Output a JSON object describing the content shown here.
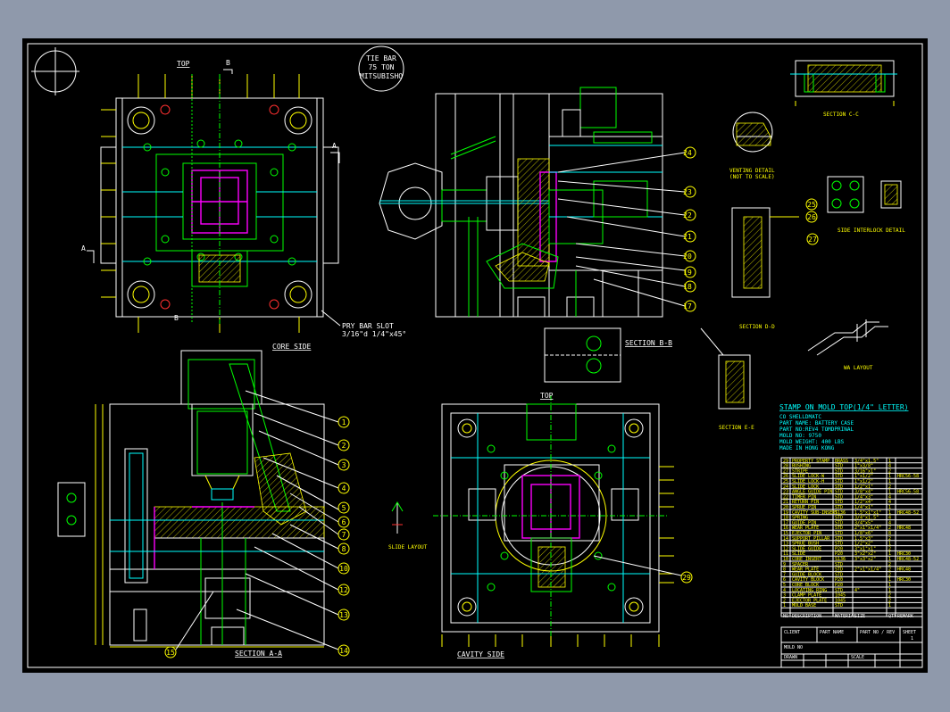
{
  "views": {
    "top_left": "TOP",
    "core_side": "CORE SIDE",
    "section_bb": "SECTION B-B",
    "section_aa": "SECTION A-A",
    "top_right": "TOP",
    "cavity_side": "CAVITY SIDE",
    "section_cc": "SECTION C-C",
    "section_dd": "SECTION D-D",
    "section_ee": "SECTION E-E",
    "venting_detail": "VENTING DETAIL",
    "venting_note": "(NOT TO SCALE)",
    "side_interlock": "SIDE INTERLOCK DETAIL",
    "slide_layout": "SLIDE LAYOUT",
    "wa_layout": "WA LAYOUT"
  },
  "tie_bar": [
    "TIE BAR",
    "75 TON",
    "MITSUBISHO"
  ],
  "pry_bar_note": [
    "PRY BAR SLOT",
    "3/16\"d 1/4\"x45°"
  ],
  "cut_marks": [
    "A",
    "A",
    "B",
    "B"
  ],
  "balloons_aa": [
    "1",
    "2",
    "3",
    "4",
    "5",
    "6",
    "7",
    "8",
    "9",
    "10",
    "11",
    "12",
    "13",
    "14",
    "15"
  ],
  "balloons_bb": [
    "24",
    "23",
    "22",
    "21",
    "20",
    "19",
    "18",
    "17",
    "16"
  ],
  "balloons_other": [
    "25",
    "26",
    "27",
    "29"
  ],
  "stamp": {
    "title": "STAMP ON MOLD TOP(1/4\" LETTER)",
    "lines": [
      "CO SHELLDMATC",
      "PART NAME: BATTERY CASE",
      "PART NO:REV4 TOMDPRINAL",
      "MOLD NO: 9750",
      "MOLD WEIGHT: 400 LBS",
      "MADE IN HONG KONG"
    ]
  },
  "bom": {
    "header": [
      "NO",
      "DESCRIPTION",
      "MATERIAL",
      "SIZE",
      "QTY",
      "REMARK"
    ],
    "rows": [
      [
        "29",
        "PROPERTY STAMP",
        "BRASS",
        "3/4\"x1.5\"",
        "1",
        ""
      ],
      [
        "28",
        "BUSHING",
        "STD",
        "1\"x3/8\"",
        "4",
        ""
      ],
      [
        "27",
        "STRIPE",
        "STD",
        "3/16\"x1\"",
        "2",
        ""
      ],
      [
        "26",
        "SLIDE LOCK-W",
        "STD",
        "1\"x1/2\"",
        "1",
        "HRC56-58"
      ],
      [
        "25",
        "SLIDE LOCK-H",
        "STD",
        "1\"x1/2\"",
        "1",
        ""
      ],
      [
        "24",
        "SLIDE LOCK",
        "STD",
        "1/2\"x1\"",
        "2",
        ""
      ],
      [
        "23",
        "ANGLE GUIDE PIN",
        "STD",
        "3/8\"x4\"",
        "1",
        "HRC56-58"
      ],
      [
        "22",
        "TIMER PIN",
        "STD",
        "1/4\"x3\"",
        "4",
        ""
      ],
      [
        "21",
        "RETURN PIN",
        "STD",
        "1/2\"x4\"",
        "4",
        ""
      ],
      [
        "20",
        "SPRUE PIN",
        "STD",
        "1/4\"x1\"",
        "1",
        ""
      ],
      [
        "19",
        "CAVITY SUB-INSERT",
        "S136",
        "1.5\"x1\"x1\"",
        "1",
        "HRC48-52"
      ],
      [
        "18",
        "SPRING",
        "STD",
        "3/4\"x1.5\"",
        "4",
        ""
      ],
      [
        "17",
        "GUIDE PIN",
        "STD",
        "3/4\"x5\"",
        "4",
        ""
      ],
      [
        "16",
        "WEAR PLATE",
        "STD",
        "2\"x1\"x1/4\"",
        "2",
        "HRC48"
      ],
      [
        "15",
        "EJECTOR PIN",
        "STD",
        "1/8\"x6\"",
        "8",
        ""
      ],
      [
        "14",
        "SUPPORT PILLAR",
        "STD",
        "1.5\"x3\"",
        "2",
        ""
      ],
      [
        "13",
        "SPRUE BUSH",
        "STD",
        "1/2\"x2\"",
        "1",
        ""
      ],
      [
        "12",
        "SLIDE GUIDE",
        "P20",
        "3\"x1\"x1\"",
        "2",
        ""
      ],
      [
        "11",
        "SLIDE",
        "P20",
        "3\"x2\"x2\"",
        "1",
        "HRC30"
      ],
      [
        "10",
        "CORE INSERT",
        "S136",
        "3\"x3\"x2\"",
        "1",
        "HRC48-52"
      ],
      [
        "9",
        "SPACER",
        "STD",
        "",
        "2",
        ""
      ],
      [
        "8",
        "WEAR PLATE",
        "STD",
        "2\"x1\"x1/4\"",
        "2",
        "HRC48"
      ],
      [
        "7",
        "GUIDE BLOCK",
        "STD",
        "",
        "2",
        ""
      ],
      [
        "6",
        "CAVITY BLOCK",
        "P20",
        "",
        "1",
        "HRC30"
      ],
      [
        "5",
        "CORE BLOCK",
        "P20",
        "",
        "1",
        ""
      ],
      [
        "4",
        "LOCATING RING",
        "STD",
        "4\"",
        "1",
        ""
      ],
      [
        "3",
        "CLAMP PLATE",
        "1045",
        "",
        "2",
        ""
      ],
      [
        "2",
        "EJECTOR PLATE",
        "1045",
        "",
        "2",
        ""
      ],
      [
        "1",
        "MOLD BASE",
        "STD",
        "",
        "1",
        ""
      ]
    ]
  },
  "title_block": {
    "client": "CLIENT",
    "part_name": "PART NAME",
    "part_no": "PART NO / REV",
    "mold_no": "MOLD NO",
    "drawn": "DRAWN",
    "scale": "SCALE",
    "sheet": "SHEET",
    "sheet_value": "1"
  },
  "colors": {
    "background": "#000000",
    "frame": "#8f99ab",
    "plate": "#ffffff",
    "dimension": "#ffff00",
    "component": "#00ff00",
    "cooling": "#00ffff",
    "part": "#ff00ff"
  }
}
